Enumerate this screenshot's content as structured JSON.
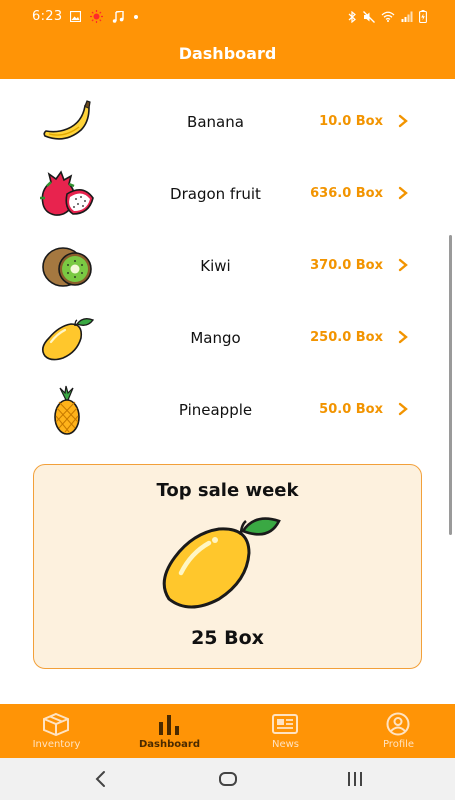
{
  "status": {
    "time": "6:23",
    "left_icons": [
      "image-icon",
      "sun-icon",
      "music-icon",
      "dot-icon"
    ],
    "right_icons": [
      "bluetooth-icon",
      "mute-icon",
      "wifi-icon",
      "signal-icon",
      "battery-icon"
    ]
  },
  "app_bar": {
    "title": "Dashboard"
  },
  "inventory": [
    {
      "name": "Banana",
      "qty": "10.0 Box",
      "icon": "banana-icon"
    },
    {
      "name": "Dragon fruit",
      "qty": "636.0 Box",
      "icon": "dragon-fruit-icon"
    },
    {
      "name": "Kiwi",
      "qty": "370.0 Box",
      "icon": "kiwi-icon"
    },
    {
      "name": "Mango",
      "qty": "250.0 Box",
      "icon": "mango-icon"
    },
    {
      "name": "Pineapple",
      "qty": "50.0 Box",
      "icon": "pineapple-icon"
    }
  ],
  "top_sale": {
    "title": "Top sale week",
    "value": "25 Box",
    "icon": "mango-icon"
  },
  "bottom_nav": [
    {
      "label": "Inventory",
      "icon": "box-icon",
      "active": false
    },
    {
      "label": "Dashboard",
      "icon": "bar-chart-icon",
      "active": true
    },
    {
      "label": "News",
      "icon": "newspaper-icon",
      "active": false
    },
    {
      "label": "Profile",
      "icon": "user-icon",
      "active": false
    }
  ],
  "system_nav": [
    "back-icon",
    "home-icon",
    "recents-icon"
  ],
  "colors": {
    "primary": "#ff9406",
    "accent_text": "#f29400",
    "card_bg": "#fdf1de",
    "card_border": "#f2a03a"
  }
}
